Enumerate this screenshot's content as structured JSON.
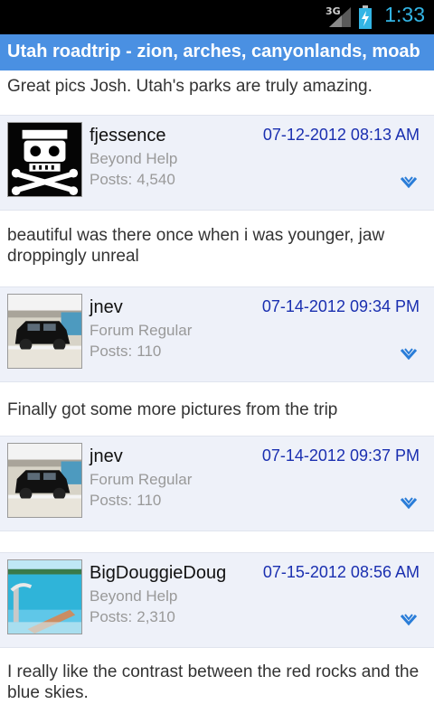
{
  "status": {
    "network": "3G",
    "time": "1:33"
  },
  "thread": {
    "title": "Utah roadtrip - zion, arches, canyonlands, moab"
  },
  "intro_message": "Great pics Josh. Utah's parks are truly amazing.",
  "posts": [
    {
      "username": "fjessence",
      "rank": "Beyond Help",
      "posts_label": "Posts:",
      "post_count": "4,540",
      "date": "07-12-2012 08:13 AM",
      "avatar_icon": "skull-jeep-avatar",
      "message": "beautiful was there once when i was younger, jaw droppingly unreal"
    },
    {
      "username": "jnev",
      "rank": "Forum Regular",
      "posts_label": "Posts:",
      "post_count": "110",
      "date": "07-14-2012 09:34 PM",
      "avatar_icon": "suv-photo-avatar",
      "message": "Finally got some more pictures from the trip"
    },
    {
      "username": "jnev",
      "rank": "Forum Regular",
      "posts_label": "Posts:",
      "post_count": "110",
      "date": "07-14-2012 09:37 PM",
      "avatar_icon": "suv-photo-avatar",
      "message": ""
    },
    {
      "username": "BigDouggieDoug",
      "rank": "Beyond Help",
      "posts_label": "Posts:",
      "post_count": "2,310",
      "date": "07-15-2012 08:56 AM",
      "avatar_icon": "beach-photo-avatar",
      "message": "I really like the contrast between the red rocks and the blue skies."
    }
  ],
  "colors": {
    "title_bar": "#4a90e2",
    "date_text": "#1a2fb0",
    "clock": "#33b5e5",
    "header_bg": "#eef1f9"
  }
}
